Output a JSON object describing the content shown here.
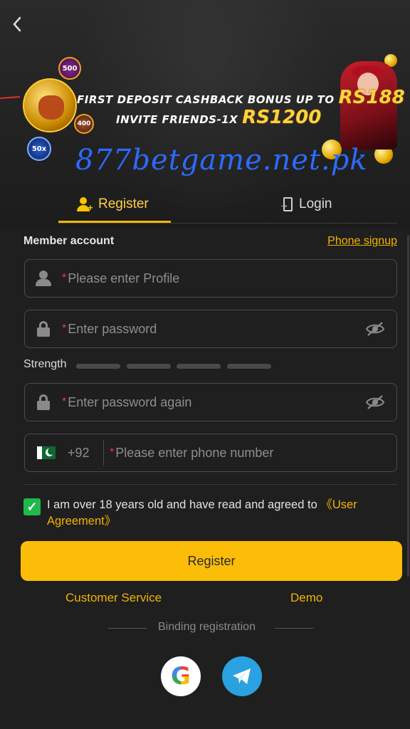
{
  "header": {
    "back_icon": "chevron-left-icon"
  },
  "banner": {
    "line1_text": "FIRST DEPOSIT CASHBACK BONUS UP TO",
    "line1_amount": "RS188",
    "line2_text": "INVITE FRIENDS-1X",
    "line2_amount": "RS1200",
    "chip_500": "500",
    "chip_400": "400",
    "chip_50": "50x",
    "watermark": "877betgame.net.pk"
  },
  "tabs": {
    "register": {
      "label": "Register",
      "icon": "user-add-icon",
      "active": true
    },
    "login": {
      "label": "Login",
      "icon": "login-icon",
      "active": false
    },
    "accent_color": "#f5b800"
  },
  "form": {
    "member_account_label": "Member account",
    "phone_signup_link": "Phone signup",
    "required_mark": "*",
    "profile": {
      "placeholder": "Please enter Profile",
      "icon": "person-icon",
      "value": ""
    },
    "password": {
      "placeholder": "Enter password",
      "icon": "lock-icon",
      "toggle_icon": "eye-off-icon",
      "value": ""
    },
    "strength_label": "Strength",
    "strength_level": 0,
    "password_confirm": {
      "placeholder": "Enter password again",
      "icon": "lock-icon",
      "toggle_icon": "eye-off-icon",
      "value": ""
    },
    "phone": {
      "country_flag": "pakistan-flag-icon",
      "country_code": "+92",
      "placeholder": "Please enter phone number",
      "value": ""
    },
    "agreement": {
      "checked": true,
      "text": "I am over 18 years old and have read and agreed to ",
      "link": "《User Agreement》"
    },
    "submit_label": "Register",
    "submit_color": "#fbbd08"
  },
  "footer": {
    "customer_service": "Customer Service",
    "demo": "Demo",
    "binding_label": "Binding registration",
    "social": [
      {
        "name": "google",
        "icon": "google-icon"
      },
      {
        "name": "telegram",
        "icon": "telegram-icon"
      }
    ]
  }
}
